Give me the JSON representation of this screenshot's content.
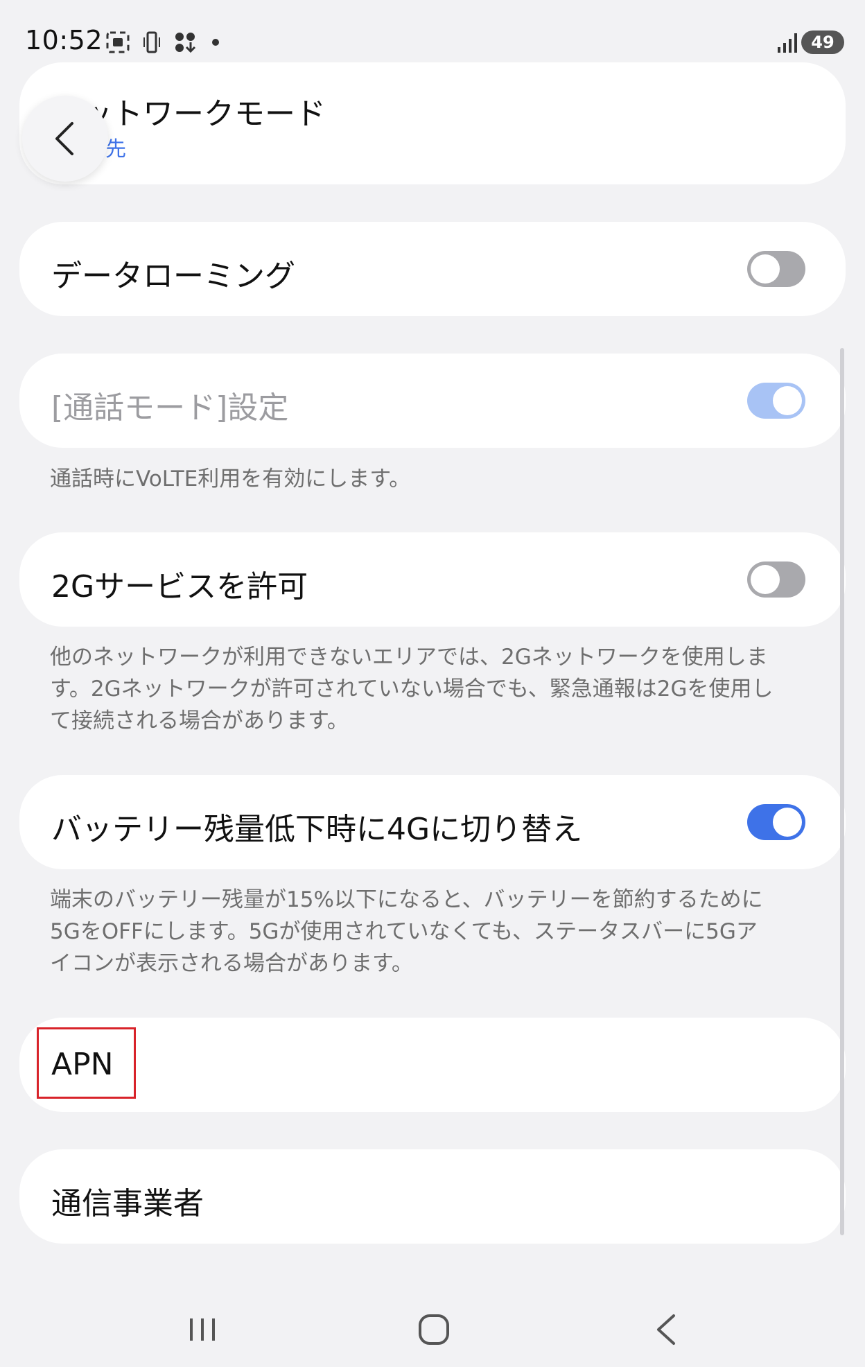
{
  "status_bar": {
    "time": "10:52",
    "battery": "49"
  },
  "network_mode": {
    "title": "ネットワークモード",
    "subtitle": "先"
  },
  "settings": [
    {
      "id": "data-roaming",
      "label": "データローミング",
      "enabled": false,
      "disabled": false
    },
    {
      "id": "call-mode",
      "label": "[通話モード]設定",
      "enabled": true,
      "disabled": true,
      "description": "通話時にVoLTE利用を有効にします。"
    },
    {
      "id": "allow-2g",
      "label": "2Gサービスを許可",
      "enabled": false,
      "disabled": false,
      "description_lines": [
        "他のネットワークが利用できないエリアでは、2Gネットワークを使用しま",
        "す。2Gネットワークが許可されていない場合でも、緊急通報は2Gを使用し",
        "て接続される場合があります。"
      ]
    },
    {
      "id": "switch-4g",
      "label": "バッテリー残量低下時に4Gに切り替え",
      "enabled": true,
      "disabled": false,
      "description_lines": [
        "端末のバッテリー残量が15%以下になると、バッテリーを節約するために",
        "5GをOFFにします。5Gが使用されていなくても、ステータスバーに5Gア",
        "イコンが表示される場合があります。"
      ]
    }
  ],
  "apn": {
    "label": "APN"
  },
  "carrier": {
    "label": "通信事業者"
  },
  "colors": {
    "accent": "#3e72e8",
    "toggle_off": "#a9a9ad",
    "toggle_disabled": "#a8c3f5",
    "highlight": "#d8232a"
  }
}
